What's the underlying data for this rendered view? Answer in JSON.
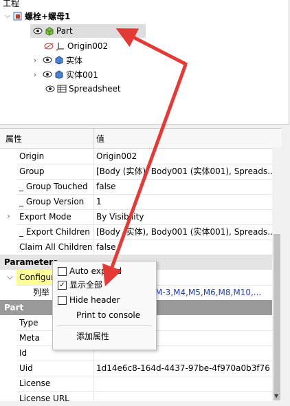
{
  "tree": {
    "section_label": "工程",
    "doc_name": "螺栓+螺母1",
    "items": [
      {
        "label": "Part"
      },
      {
        "label": "Origin002"
      },
      {
        "label": "实体"
      },
      {
        "label": "实体001"
      },
      {
        "label": "Spreadsheet"
      }
    ]
  },
  "properties": {
    "col_property": "属性",
    "col_value": "值",
    "rows": [
      {
        "name": "Origin",
        "value": "Origin002"
      },
      {
        "name": "Group",
        "value": "[Body (实体), Body001 (实体001), Spreads..."
      },
      {
        "name": "_ Group Touched",
        "value": "false"
      },
      {
        "name": "_ Group Version",
        "value": "1"
      },
      {
        "name": "Export Mode",
        "value": "By Visibility"
      },
      {
        "name": "_ Export Children",
        "value": "[Body (实体), Body001 (实体001), Spreads..."
      },
      {
        "name": "Claim All Children",
        "value": "false"
      }
    ],
    "group_parameters": "Parameters",
    "configure_label": "Configur",
    "enum_label": "列举",
    "enum_value": "M-3,M4,M5,M6,M8,M10,...",
    "group_part": "Part",
    "part_rows": [
      {
        "name": "Type",
        "value": ""
      },
      {
        "name": "Meta",
        "value": ""
      },
      {
        "name": "Id",
        "value": ""
      },
      {
        "name": "Uid",
        "value": "1d14e6c8-164d-4437-97be-4f970a0b3f76"
      },
      {
        "name": "License",
        "value": ""
      },
      {
        "name": "License URL",
        "value": ""
      }
    ]
  },
  "context_menu": {
    "items": [
      {
        "label": "Auto expand",
        "checked": false
      },
      {
        "label": "显示全部",
        "checked": true
      },
      {
        "label": "Hide header",
        "checked": false
      },
      {
        "label": "Print to console"
      },
      {
        "label": "添加属性"
      }
    ]
  },
  "colors": {
    "arrow": "#e53935",
    "link_blue": "#1f3fbf",
    "config_highlight": "#ffff99"
  }
}
